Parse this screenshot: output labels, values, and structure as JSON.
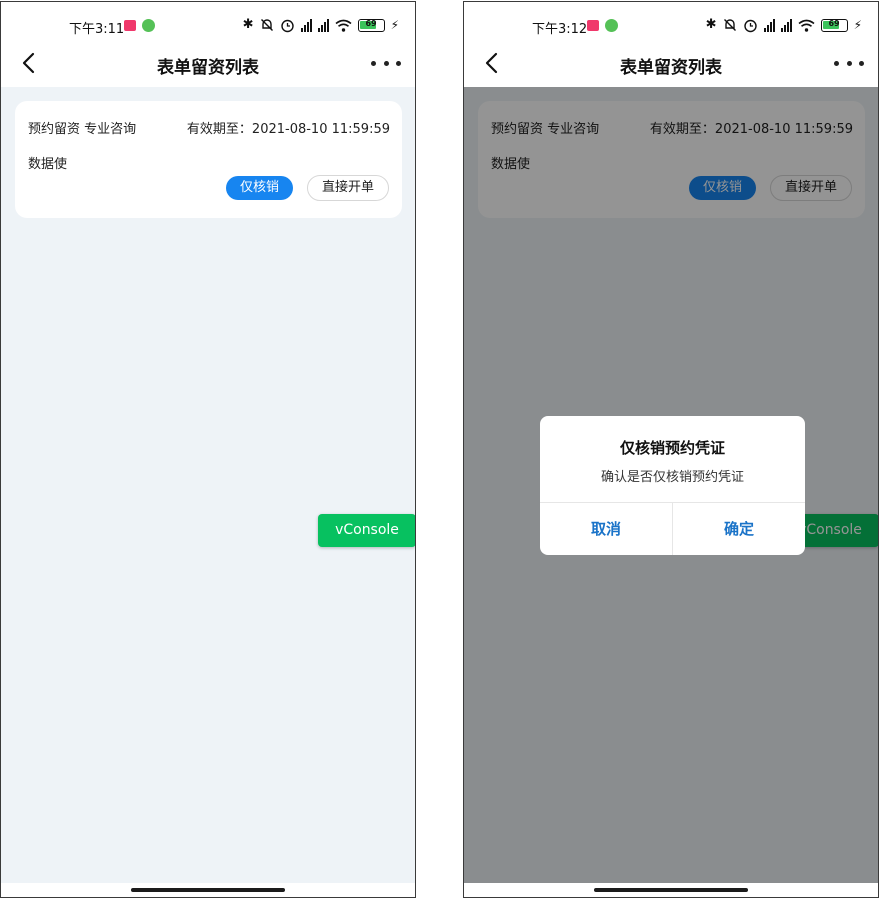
{
  "screens": [
    {
      "status": {
        "time": "下午3:11",
        "battery": "69",
        "bluetooth": "✱"
      },
      "nav": {
        "title": "表单留资列表"
      },
      "card": {
        "name": "预约留资 专业咨询",
        "expire": "有效期至：2021-08-10 11:59:59",
        "user": "数据使",
        "btn_verify": "仅核销",
        "btn_open": "直接开单"
      },
      "vconsole": "vConsole"
    },
    {
      "status": {
        "time": "下午3:12",
        "battery": "69",
        "bluetooth": "✱"
      },
      "nav": {
        "title": "表单留资列表"
      },
      "card": {
        "name": "预约留资 专业咨询",
        "expire": "有效期至：2021-08-10 11:59:59",
        "user": "数据使",
        "btn_verify": "仅核销",
        "btn_open": "直接开单"
      },
      "vconsole": "vConsole",
      "dialog": {
        "title": "仅核销预约凭证",
        "message": "确认是否仅核销预约凭证",
        "cancel": "取消",
        "confirm": "确定"
      }
    }
  ],
  "colors": {
    "primary_blue": "#1785f0",
    "vconsole_green": "#07c160",
    "dialog_button_blue": "#1a73c8",
    "page_bg": "#eef3f7"
  },
  "icons": [
    "back-arrow-icon",
    "more-dots-icon",
    "bluetooth-icon",
    "bell-muted-icon",
    "alarm-icon",
    "signal-icon",
    "wifi-icon",
    "battery-icon",
    "charging-icon"
  ]
}
